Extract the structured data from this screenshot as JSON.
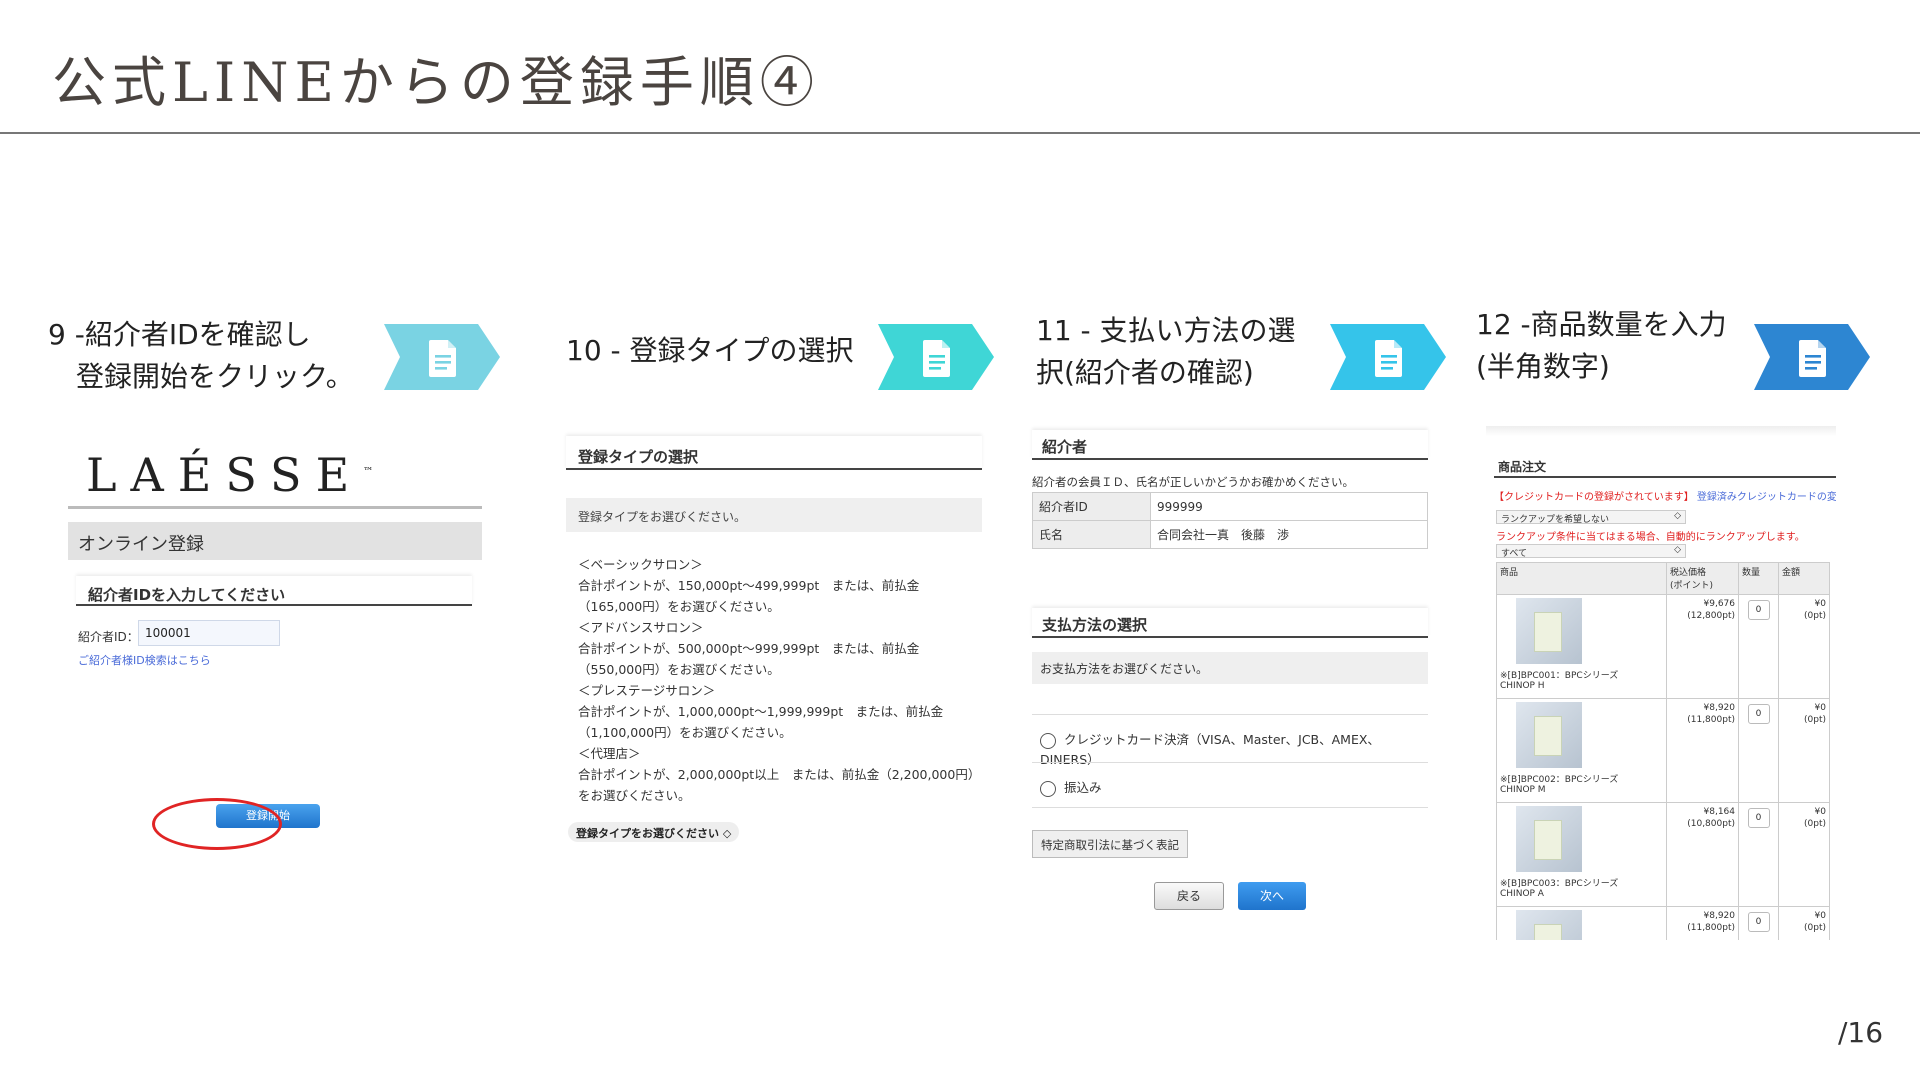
{
  "header": {
    "title": "公式LINEからの登録手順④",
    "page_number": "/16"
  },
  "steps": [
    {
      "line1": "9 -紹介者IDを確認し",
      "line2": "　登録開始をクリック。"
    },
    {
      "line1": "10 - 登録タイプの選択",
      "line2": ""
    },
    {
      "line1": "11 - 支払い方法の選",
      "line2": "択(紹介者の確認)"
    },
    {
      "line1": "12 -商品数量を入力",
      "line2": "(半角数字)"
    }
  ],
  "arrow_colors": [
    "#7ad3e3",
    "#3fd6d6",
    "#35c4ea",
    "#2d86d2"
  ],
  "icon": "document-icon",
  "panel9": {
    "logo": "LAÉSSE",
    "logo_tm": "™",
    "band": "オンライン登録",
    "box_title": "紹介者IDを入力してください",
    "field_label": "紹介者ID：",
    "field_value": "100001",
    "link": "ご紹介者様ID検索はこちら",
    "button": "登録開始"
  },
  "panel10": {
    "head": "登録タイプの選択",
    "prompt": "登録タイプをお選びください。",
    "lines": [
      "＜ベーシックサロン＞",
      "合計ポイントが、150,000pt〜499,999pt　または、前払金",
      "（165,000円）をお選びください。",
      "＜アドバンスサロン＞",
      "合計ポイントが、500,000pt〜999,999pt　または、前払金",
      "（550,000円）をお選びください。",
      "＜プレステージサロン＞",
      "合計ポイントが、1,000,000pt〜1,999,999pt　または、前払金",
      "（1,100,000円）をお選びください。",
      "＜代理店＞",
      "合計ポイントが、2,000,000pt以上　または、前払金（2,200,000円）",
      "をお選びください。"
    ],
    "select": "登録タイプをお選びください ◇"
  },
  "panel11": {
    "head1": "紹介者",
    "note": "紹介者の会員ＩＤ、氏名が正しいかどうかお確かめください。",
    "rows": [
      {
        "k": "紹介者ID",
        "v": "999999"
      },
      {
        "k": "氏名",
        "v": "合同会社一真　後藤　渉"
      }
    ],
    "head2": "支払方法の選択",
    "prompt": "お支払方法をお選びください。",
    "opt1": "クレジットカード決済（VISA、Master、JCB、AMEX、DINERS）",
    "opt2": "振込み",
    "law": "特定商取引法に基づく表記",
    "back": "戻る",
    "next": "次へ"
  },
  "panel12": {
    "head": "商品注文",
    "red_note": "【クレジットカードの登録がされています】",
    "blue_note": "登録済みクレジットカードの変更",
    "select1": "ランクアップを希望しない",
    "red_note2": "ランクアップ条件に当てはまる場合、自動的にランクアップします。",
    "select2": "すべて",
    "columns": [
      "商品",
      "税込価格\n(ポイント)",
      "数量",
      "金額"
    ],
    "products": [
      {
        "name": "※[B]BPC001：BPCシリーズ\nCHINOP H",
        "price": "¥9,676\n(12,800pt)",
        "qty": "0",
        "amount": "¥0\n(0pt)"
      },
      {
        "name": "※[B]BPC002：BPCシリーズ\nCHINOP M",
        "price": "¥8,920\n(11,800pt)",
        "qty": "0",
        "amount": "¥0\n(0pt)"
      },
      {
        "name": "※[B]BPC003：BPCシリーズ\nCHINOP A",
        "price": "¥8,164\n(10,800pt)",
        "qty": "0",
        "amount": "¥0\n(0pt)"
      },
      {
        "name": "",
        "price": "¥8,920\n(11,800pt)",
        "qty": "0",
        "amount": "¥0\n(0pt)"
      }
    ]
  }
}
